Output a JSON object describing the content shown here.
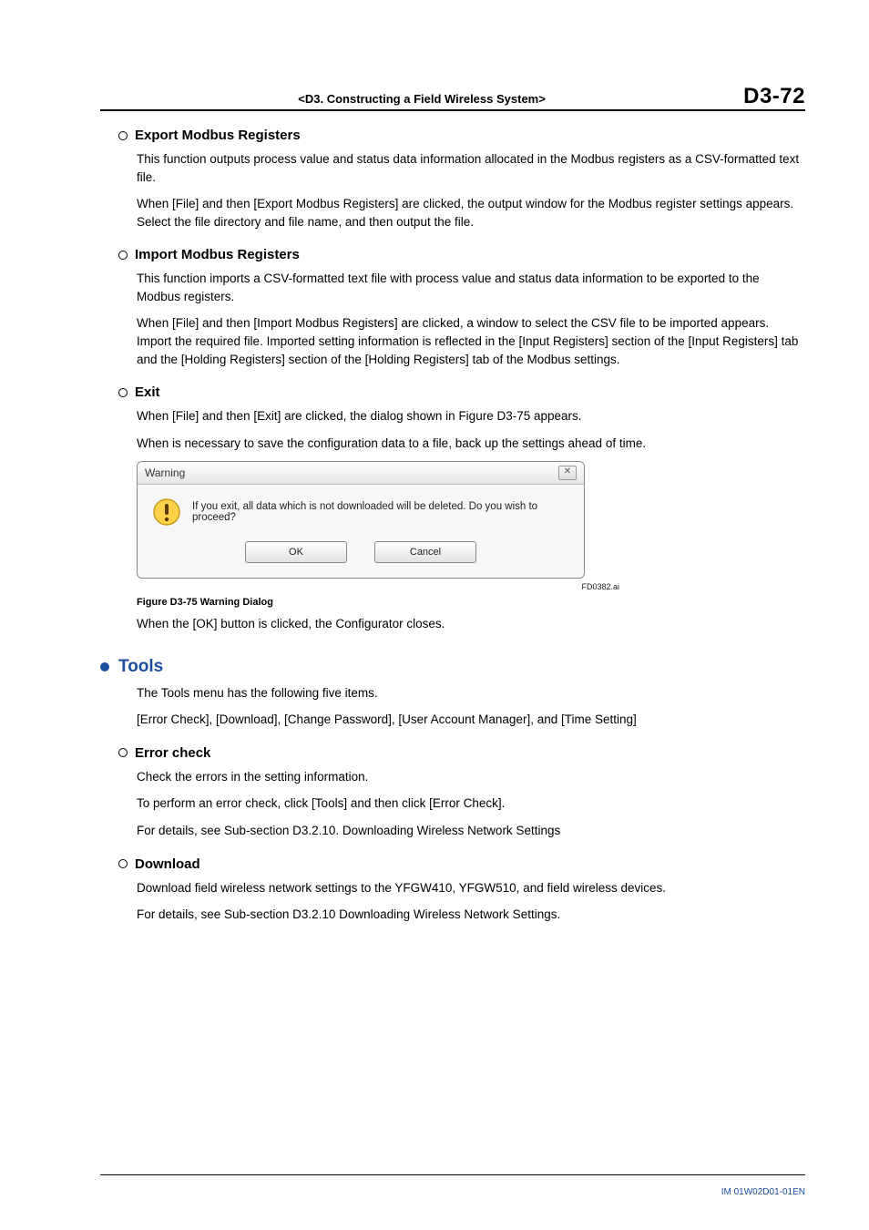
{
  "header": {
    "center": "<D3.  Constructing a Field Wireless System>",
    "right": "D3-72"
  },
  "sections": {
    "export": {
      "title": "Export Modbus Registers",
      "p1": "This function outputs process value and status data information allocated in the Modbus registers as a CSV-formatted text file.",
      "p2": "When [File] and then [Export Modbus Registers] are clicked, the output window for the Modbus register settings appears. Select the file directory and file name, and then output the file."
    },
    "import": {
      "title": "Import Modbus Registers",
      "p1": "This function imports a CSV-formatted text file with process value and status data information to be exported to the Modbus registers.",
      "p2": "When [File] and then [Import Modbus Registers] are clicked, a window to select the CSV file to be imported appears. Import the required file. Imported setting information is reflected in the [Input Registers] section of the [Input Registers] tab and the [Holding Registers] section of the [Holding Registers] tab of the Modbus settings."
    },
    "exit": {
      "title": "Exit",
      "p1": "When [File] and then [Exit] are clicked, the dialog shown in Figure D3-75 appears.",
      "p2": "When is necessary to save the configuration data to a file, back up the settings ahead of time."
    },
    "dialog": {
      "title": "Warning",
      "message": "If you exit, all data which is not downloaded will be deleted. Do you wish to proceed?",
      "ok": "OK",
      "cancel": "Cancel",
      "figref": "FD0382.ai",
      "caption": "Figure D3-75  Warning Dialog",
      "after": "When the [OK] button is clicked, the Configurator closes."
    },
    "tools": {
      "title": "Tools",
      "p1": "The Tools menu has the following five items.",
      "p2": "[Error Check], [Download], [Change Password], [User Account Manager], and [Time Setting]"
    },
    "errorcheck": {
      "title": "Error check",
      "p1": "Check the errors in the setting information.",
      "p2": "To perform an error check, click [Tools] and then click [Error Check].",
      "p3": "For details, see Sub-section D3.2.10. Downloading Wireless Network Settings"
    },
    "download": {
      "title": "Download",
      "p1": "Download field wireless network settings to the YFGW410, YFGW510, and field wireless devices.",
      "p2": "For details, see Sub-section D3.2.10 Downloading Wireless Network Settings."
    }
  },
  "footer": {
    "doc": "IM 01W02D01-01EN"
  }
}
